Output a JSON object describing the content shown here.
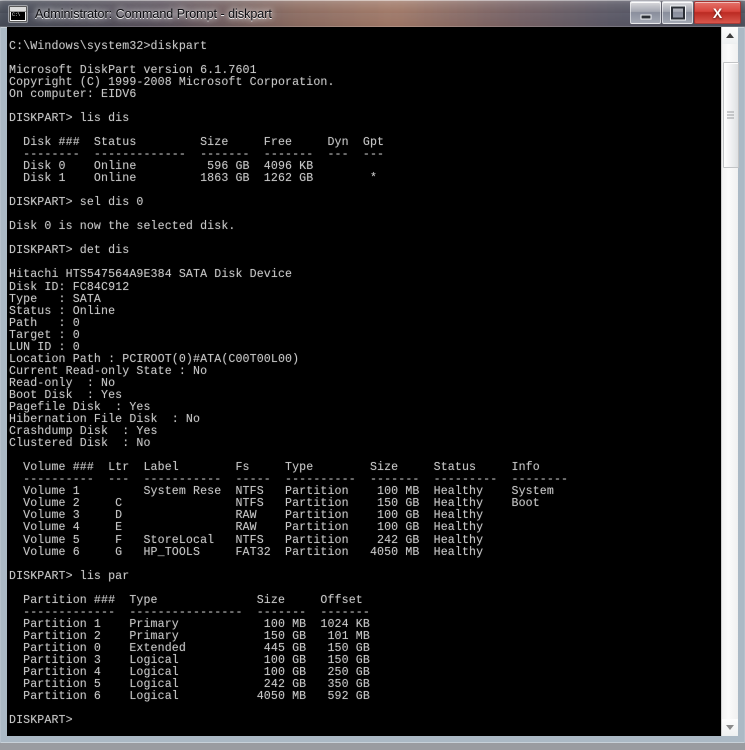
{
  "window": {
    "title": "Administrator: Command Prompt - diskpart",
    "icon": "cmd-console-icon",
    "buttons": {
      "minimize": "minimize",
      "maximize": "maximize",
      "close": "X"
    }
  },
  "scrollbar": {
    "up_arrow": "scroll-up",
    "down_arrow": "scroll-down",
    "thumb": "scroll-thumb"
  },
  "console": {
    "prompt_cwd": "C:\\Windows\\system32>",
    "diskpart_prompt": "DISKPART>",
    "commands": [
      "diskpart",
      "lis dis",
      "sel dis 0",
      "det dis",
      "lis par"
    ],
    "version_line": "Microsoft DiskPart version 6.1.7601",
    "copyright_line": "Copyright (C) 1999-2008 Microsoft Corporation.",
    "computer_line": "On computer: EIDV6",
    "select_result": "Disk 0 is now the selected disk.",
    "disk_table": {
      "headers": [
        "Disk ###",
        "Status",
        "Size",
        "Free",
        "Dyn",
        "Gpt"
      ],
      "rows": [
        [
          "Disk 0",
          "Online",
          "596 GB",
          "4096 KB",
          "",
          ""
        ],
        [
          "Disk 1",
          "Online",
          "1863 GB",
          "1262 GB",
          "",
          "*"
        ]
      ]
    },
    "disk_detail": {
      "model": "Hitachi HTS547564A9E384 SATA Disk Device",
      "disk_id_label": "Disk ID:",
      "disk_id": "FC84C912",
      "fields": [
        {
          "label": "Type",
          "value": "SATA"
        },
        {
          "label": "Status",
          "value": "Online"
        },
        {
          "label": "Path",
          "value": "0"
        },
        {
          "label": "Target",
          "value": "0"
        },
        {
          "label": "LUN ID",
          "value": "0"
        }
      ],
      "location_path_label": "Location Path :",
      "location_path": "PCIROOT(0)#ATA(C00T00L00)",
      "flags": [
        {
          "label": "Current Read-only State :",
          "value": "No"
        },
        {
          "label": "Read-only  :",
          "value": "No"
        },
        {
          "label": "Boot Disk  :",
          "value": "Yes"
        },
        {
          "label": "Pagefile Disk  :",
          "value": "Yes"
        },
        {
          "label": "Hibernation File Disk  :",
          "value": "No"
        },
        {
          "label": "Crashdump Disk  :",
          "value": "Yes"
        },
        {
          "label": "Clustered Disk  :",
          "value": "No"
        }
      ]
    },
    "volume_table": {
      "headers": [
        "Volume ###",
        "Ltr",
        "Label",
        "Fs",
        "Type",
        "Size",
        "Status",
        "Info"
      ],
      "rows": [
        [
          "Volume 1",
          "",
          "System Rese",
          "NTFS",
          "Partition",
          "100 MB",
          "Healthy",
          "System"
        ],
        [
          "Volume 2",
          "C",
          "",
          "NTFS",
          "Partition",
          "150 GB",
          "Healthy",
          "Boot"
        ],
        [
          "Volume 3",
          "D",
          "",
          "RAW",
          "Partition",
          "100 GB",
          "Healthy",
          ""
        ],
        [
          "Volume 4",
          "E",
          "",
          "RAW",
          "Partition",
          "100 GB",
          "Healthy",
          ""
        ],
        [
          "Volume 5",
          "F",
          "StoreLocal",
          "NTFS",
          "Partition",
          "242 GB",
          "Healthy",
          ""
        ],
        [
          "Volume 6",
          "G",
          "HP_TOOLS",
          "FAT32",
          "Partition",
          "4050 MB",
          "Healthy",
          ""
        ]
      ]
    },
    "partition_table": {
      "headers": [
        "Partition ###",
        "Type",
        "Size",
        "Offset"
      ],
      "rows": [
        [
          "Partition 1",
          "Primary",
          "100 MB",
          "1024 KB"
        ],
        [
          "Partition 2",
          "Primary",
          "150 GB",
          "101 MB"
        ],
        [
          "Partition 0",
          "Extended",
          "445 GB",
          "150 GB"
        ],
        [
          "Partition 3",
          "Logical",
          "100 GB",
          "150 GB"
        ],
        [
          "Partition 4",
          "Logical",
          "100 GB",
          "250 GB"
        ],
        [
          "Partition 5",
          "Logical",
          "242 GB",
          "350 GB"
        ],
        [
          "Partition 6",
          "Logical",
          "4050 MB",
          "592 GB"
        ]
      ]
    },
    "full_text": "C:\\Windows\\system32>diskpart\n\nMicrosoft DiskPart version 6.1.7601\nCopyright (C) 1999-2008 Microsoft Corporation.\nOn computer: EIDV6\n\nDISKPART> lis dis\n\n  Disk ###  Status         Size     Free     Dyn  Gpt\n  --------  -------------  -------  -------  ---  ---\n  Disk 0    Online          596 GB  4096 KB\n  Disk 1    Online         1863 GB  1262 GB        *\n\nDISKPART> sel dis 0\n\nDisk 0 is now the selected disk.\n\nDISKPART> det dis\n\nHitachi HTS547564A9E384 SATA Disk Device\nDisk ID: FC84C912\nType   : SATA\nStatus : Online\nPath   : 0\nTarget : 0\nLUN ID : 0\nLocation Path : PCIROOT(0)#ATA(C00T00L00)\nCurrent Read-only State : No\nRead-only  : No\nBoot Disk  : Yes\nPagefile Disk  : Yes\nHibernation File Disk  : No\nCrashdump Disk  : Yes\nClustered Disk  : No\n\n  Volume ###  Ltr  Label        Fs     Type        Size     Status     Info\n  ----------  ---  -----------  -----  ----------  -------  ---------  --------\n  Volume 1         System Rese  NTFS   Partition    100 MB  Healthy    System\n  Volume 2     C                NTFS   Partition    150 GB  Healthy    Boot\n  Volume 3     D                RAW    Partition    100 GB  Healthy\n  Volume 4     E                RAW    Partition    100 GB  Healthy\n  Volume 5     F   StoreLocal   NTFS   Partition    242 GB  Healthy\n  Volume 6     G   HP_TOOLS     FAT32  Partition   4050 MB  Healthy\n\nDISKPART> lis par\n\n  Partition ###  Type              Size     Offset\n  -------------  ----------------  -------  -------\n  Partition 1    Primary            100 MB  1024 KB\n  Partition 2    Primary            150 GB   101 MB\n  Partition 0    Extended           445 GB   150 GB\n  Partition 3    Logical            100 GB   150 GB\n  Partition 4    Logical            100 GB   250 GB\n  Partition 5    Logical            242 GB   350 GB\n  Partition 6    Logical           4050 MB   592 GB\n\nDISKPART>"
  }
}
